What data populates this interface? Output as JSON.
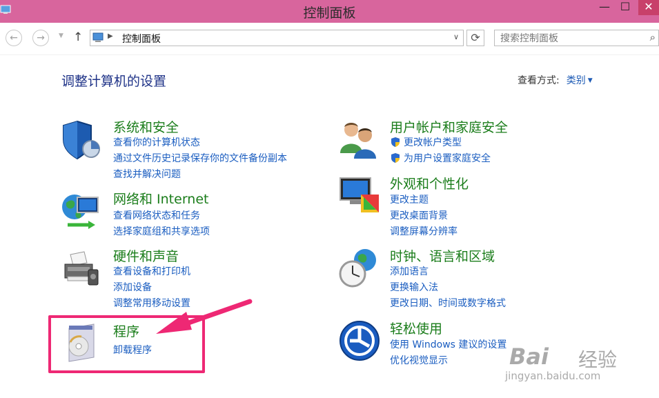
{
  "window": {
    "title": "控制面板"
  },
  "nav": {
    "breadcrumb": "控制面板"
  },
  "search": {
    "placeholder": "搜索控制面板"
  },
  "page": {
    "heading": "调整计算机的设置",
    "view_by_label": "查看方式:",
    "view_by_value": "类别"
  },
  "categories": [
    {
      "title": "系统和安全",
      "links": [
        "查看你的计算机状态",
        "通过文件历史记录保存你的文件备份副本",
        "查找并解决问题"
      ],
      "icon": "shield-icon"
    },
    {
      "title": "网络和 Internet",
      "links": [
        "查看网络状态和任务",
        "选择家庭组和共享选项"
      ],
      "icon": "network-icon"
    },
    {
      "title": "硬件和声音",
      "links": [
        "查看设备和打印机",
        "添加设备",
        "调整常用移动设置"
      ],
      "icon": "printer-icon"
    },
    {
      "title": "程序",
      "links": [
        "卸载程序"
      ],
      "icon": "programs-icon"
    },
    {
      "title": "用户帐户和家庭安全",
      "links": [
        "更改帐户类型",
        "为用户设置家庭安全"
      ],
      "icon": "users-icon"
    },
    {
      "title": "外观和个性化",
      "links": [
        "更改主题",
        "更改桌面背景",
        "调整屏幕分辨率"
      ],
      "icon": "appearance-icon"
    },
    {
      "title": "时钟、语言和区域",
      "links": [
        "添加语言",
        "更换输入法",
        "更改日期、时间或数字格式"
      ],
      "icon": "clock-globe-icon"
    },
    {
      "title": "轻松使用",
      "links": [
        "使用 Windows 建议的设置",
        "优化视觉显示"
      ],
      "icon": "ease-of-access-icon"
    }
  ],
  "watermark": {
    "brand_text": "Bai",
    "brand_cn": "经验",
    "url": "jingyan.baidu.com"
  },
  "colors": {
    "titlebar": "#d8659d",
    "heading": "#1e3287",
    "category_title": "#1b7d1b",
    "link": "#1a5dc0",
    "annotation": "#ee2874"
  }
}
